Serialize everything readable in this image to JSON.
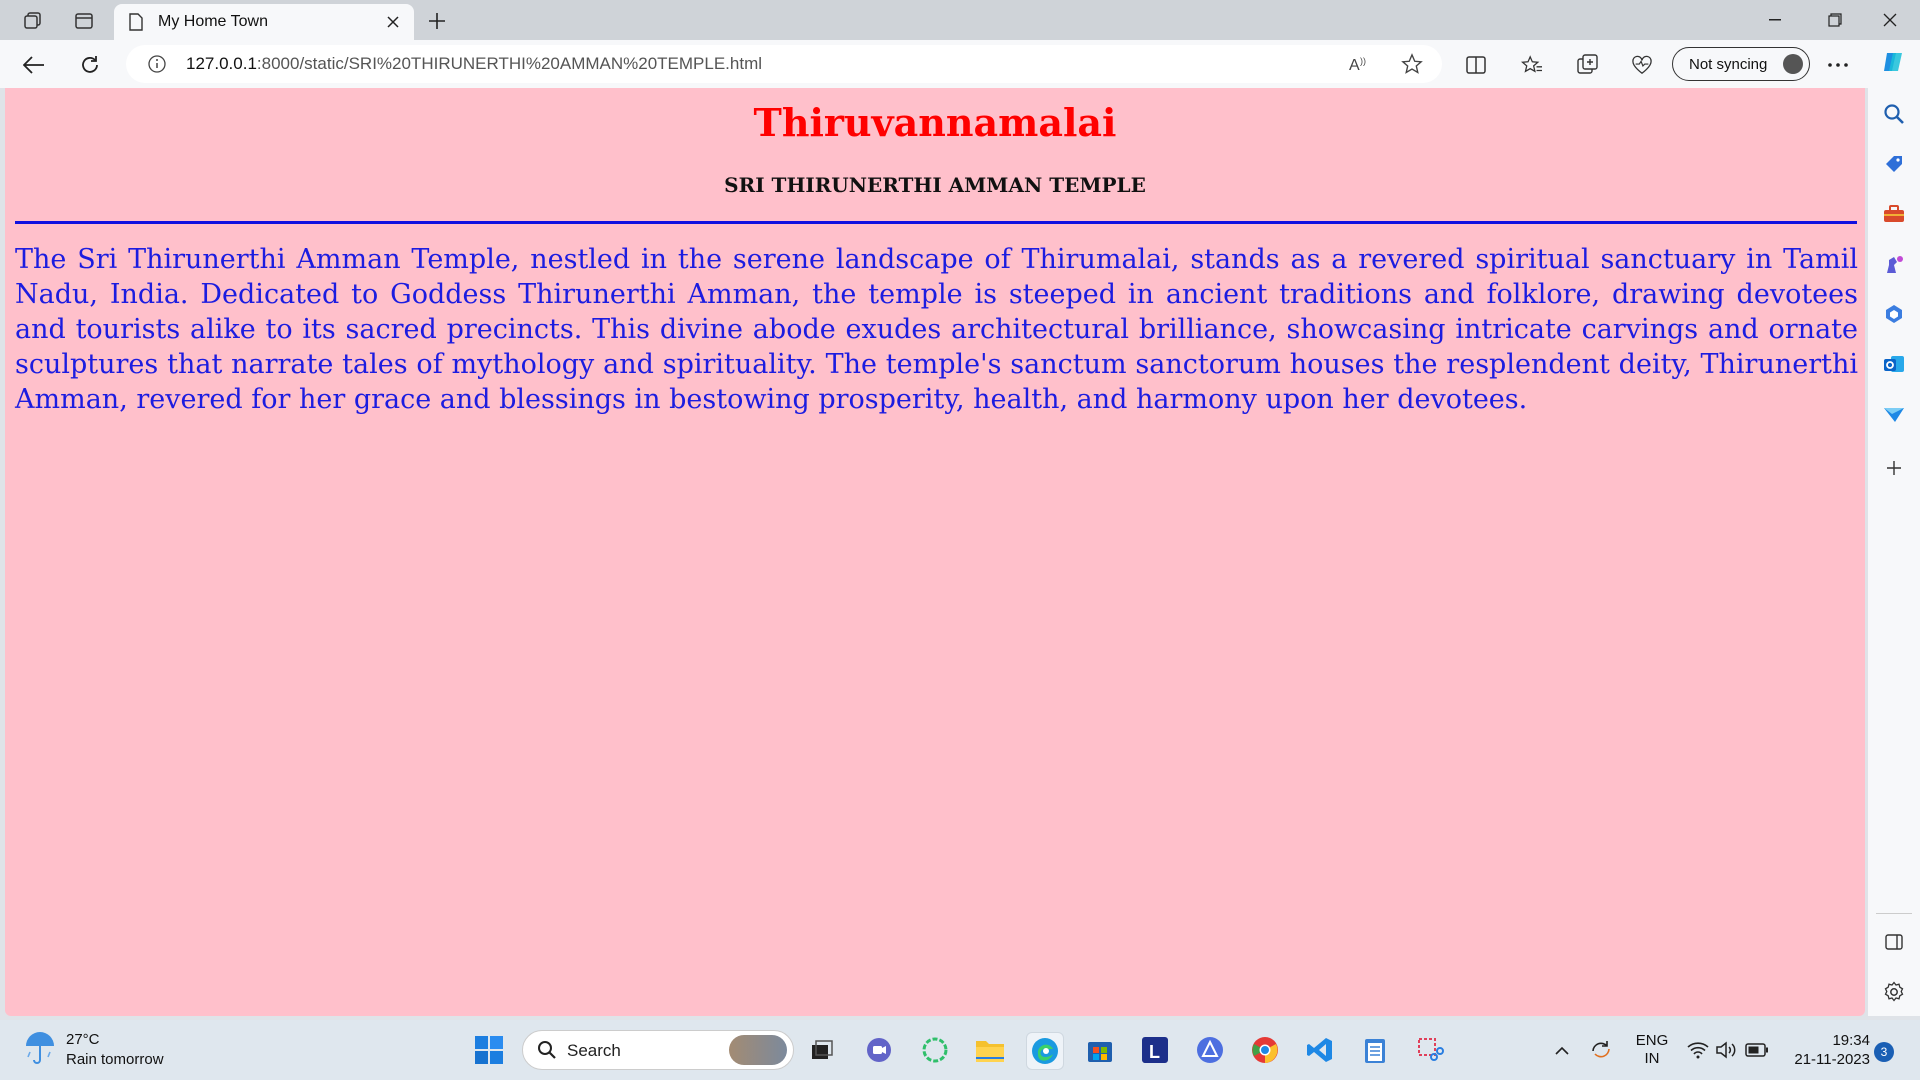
{
  "browser": {
    "tab": {
      "title": "My Home Town"
    },
    "address": {
      "host": "127.0.0.1",
      "path": ":8000/static/SRI%20THIRUNERTHI%20AMMAN%20TEMPLE.html"
    },
    "sync_label": "Not syncing"
  },
  "page": {
    "background": "#ffc0cb",
    "title": "Thiruvannamalai",
    "title_color": "#ff0000",
    "subtitle": "SRI THIRUNERTHI AMMAN TEMPLE",
    "divider_color": "#1010e0",
    "paragraph_color": "#1c1ce0",
    "paragraph": "The Sri Thirunerthi Amman Temple, nestled in the serene landscape of Thirumalai, stands as a revered spiritual sanctuary in Tamil Nadu, India. Dedicated to Goddess Thirunerthi Amman, the temple is steeped in ancient traditions and folklore, drawing devotees and tourists alike to its sacred precincts. This divine abode exudes architectural brilliance, showcasing intricate carvings and ornate sculptures that narrate tales of mythology and spirituality. The temple's sanctum sanctorum houses the resplendent deity, Thirunerthi Amman, revered for her grace and blessings in bestowing prosperity, health, and harmony upon her devotees."
  },
  "taskbar": {
    "weather": {
      "temp": "27°C",
      "forecast": "Rain tomorrow"
    },
    "search_label": "Search",
    "language": {
      "line1": "ENG",
      "line2": "IN"
    },
    "clock": {
      "time": "19:34",
      "date": "21-11-2023"
    },
    "notifications": "3"
  }
}
